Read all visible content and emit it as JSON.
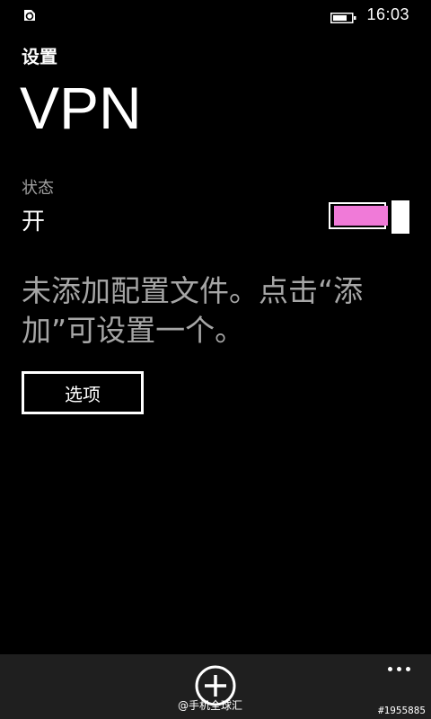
{
  "status_bar": {
    "left_icon": "sync-icon",
    "battery_icon": "battery-icon",
    "time": "16:03"
  },
  "header": {
    "app_title": "设置",
    "page_title": "VPN"
  },
  "status": {
    "label": "状态",
    "value": "开",
    "toggle_on": true,
    "toggle_accent": "#f07ad8"
  },
  "main": {
    "message": "未添加配置文件。点击“添加”可设置一个。",
    "options_label": "选项"
  },
  "app_bar": {
    "add_icon": "add-icon",
    "more_icon": "more-icon"
  },
  "watermarks": {
    "center": "@手机全球汇",
    "right": "#1955885"
  }
}
